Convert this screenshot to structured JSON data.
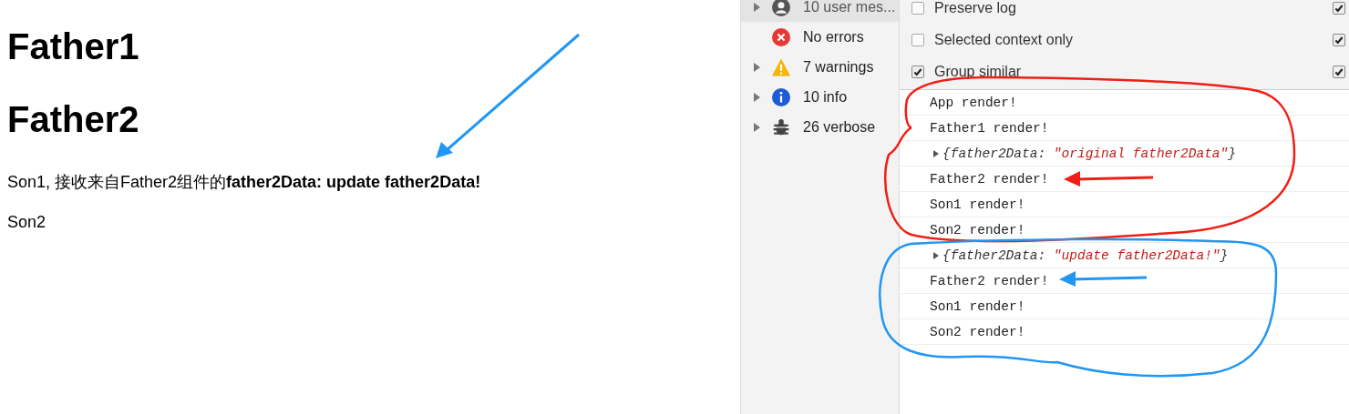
{
  "page": {
    "headings": [
      "Father1",
      "Father2"
    ],
    "paragraphs": [
      "Son1, 接收来自Father2组件的**father2Data: update father2Data!**",
      "Son2"
    ]
  },
  "sidebar": {
    "items": [
      {
        "kind": "user",
        "label": "10 user mes...",
        "expandable": true,
        "selected": true
      },
      {
        "kind": "error",
        "label": "No errors",
        "expandable": false,
        "selected": false
      },
      {
        "kind": "warning",
        "label": "7 warnings",
        "expandable": true,
        "selected": false
      },
      {
        "kind": "info",
        "label": "10 info",
        "expandable": true,
        "selected": false
      },
      {
        "kind": "verbose",
        "label": "26 verbose",
        "expandable": true,
        "selected": false
      }
    ]
  },
  "settings": {
    "left": [
      {
        "label": "Preserve log",
        "checked": false
      },
      {
        "label": "Selected context only",
        "checked": false
      },
      {
        "label": "Group similar",
        "checked": true
      }
    ],
    "right": [
      {
        "checked": true
      },
      {
        "checked": true
      },
      {
        "checked": true
      }
    ]
  },
  "console": {
    "rows": [
      {
        "kind": "log",
        "text": "App render!"
      },
      {
        "kind": "log",
        "text": "Father1 render!"
      },
      {
        "kind": "object",
        "prefix": "{father2Data: ",
        "value": "\"original father2Data\"",
        "suffix": "}"
      },
      {
        "kind": "log",
        "text": "Father2 render!"
      },
      {
        "kind": "log",
        "text": "Son1 render!"
      },
      {
        "kind": "log",
        "text": "Son2 render!"
      },
      {
        "kind": "object",
        "prefix": "{father2Data: ",
        "value": "\"update father2Data!\"",
        "suffix": "}"
      },
      {
        "kind": "log",
        "text": "Father2 render!"
      },
      {
        "kind": "log",
        "text": "Son1 render!"
      },
      {
        "kind": "log",
        "text": "Son2 render!"
      }
    ]
  },
  "annotations": [
    {
      "kind": "arrow",
      "color": "#2196f3"
    },
    {
      "kind": "loop",
      "color": "#f01e14"
    },
    {
      "kind": "arrow",
      "color": "#f01e14"
    },
    {
      "kind": "loop",
      "color": "#2196f3"
    },
    {
      "kind": "arrow",
      "color": "#2196f3"
    }
  ]
}
